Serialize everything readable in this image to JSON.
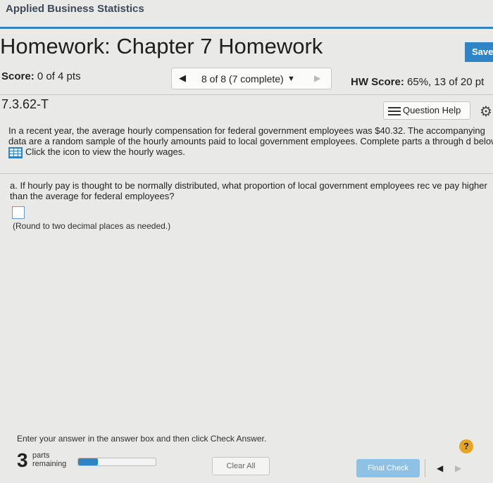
{
  "app": {
    "title": "Applied Business Statistics"
  },
  "header": {
    "title": "Homework: Chapter 7 Homework",
    "save_label": "Save"
  },
  "score": {
    "label": "Score:",
    "value": "0 of 4 pts"
  },
  "question_nav": {
    "prev_icon": "left-triangle-icon",
    "text": "8 of 8 (7 complete)",
    "dropdown_icon": "down-triangle-icon",
    "next_icon": "right-triangle-icon"
  },
  "hw_score": {
    "label": "HW Score:",
    "value": "65%, 13 of 20 pt"
  },
  "question": {
    "id": "7.3.62-T",
    "help_label": "Question Help",
    "help_icon": "list-icon",
    "settings_icon": "gear-icon"
  },
  "intro": {
    "line1": "In a recent year, the average hourly compensation for federal government employees was $40.32. The accompanying",
    "line2": "data are a random sample of the hourly amounts paid to local government employees. Complete parts a through d below.",
    "data_icon": "data-table-icon",
    "line3": "Click the icon to view the hourly wages."
  },
  "part_a": {
    "line1": "a. If hourly pay is thought to be normally distributed, what proportion of local government employees rec",
    "line1_end": "ve pay higher",
    "line2": "than the average for federal employees?",
    "answer_value": "",
    "note": "(Round to two decimal places as needed.)"
  },
  "footer": {
    "instruction": "Enter your answer in the answer box and then click Check Answer.",
    "help_icon_text": "?",
    "parts_count": "3",
    "parts_label_1": "parts",
    "parts_label_2": "remaining",
    "progress_fraction": 0.25,
    "clear_all_label": "Clear All",
    "final_check_label": "Final Check"
  },
  "colors": {
    "accent": "#2f84c6",
    "help_badge": "#e8a523"
  }
}
